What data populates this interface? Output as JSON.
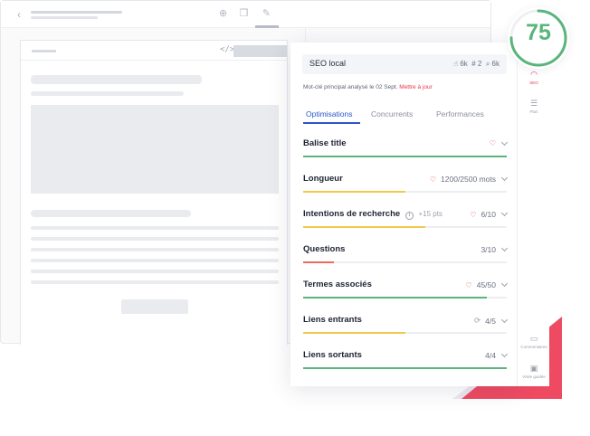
{
  "score": {
    "value": 75,
    "max": 100,
    "color": "#59b57b"
  },
  "keyword": {
    "text": "SEO local",
    "stat1": "6k",
    "rank": "# 2",
    "stat2": "6k"
  },
  "analysis": {
    "text": "Mot-clé principal analysé le 02 Sept.",
    "update_label": "Mettre à jour"
  },
  "tabs": [
    {
      "label": "Optimisations",
      "active": true
    },
    {
      "label": "Concurrents",
      "active": false
    },
    {
      "label": "Performances",
      "active": false
    }
  ],
  "rows": [
    {
      "label": "Balise title",
      "value": "",
      "icon": "trophy-icon",
      "progress": 1.0,
      "bar_color": "#59b57b"
    },
    {
      "label": "Longueur",
      "value": "1200/2500 mots",
      "icon": "trophy-icon",
      "progress": 0.5,
      "bar_color": "#f2c94c"
    },
    {
      "label": "Intentions de recherche",
      "extra": "+15 pts",
      "value": "6/10",
      "icon": "trophy-icon",
      "progress": 0.6,
      "bar_color": "#f2c94c"
    },
    {
      "label": "Questions",
      "value": "3/10",
      "icon": "",
      "progress": 0.15,
      "bar_color": "#ee6a5f"
    },
    {
      "label": "Termes associés",
      "value": "45/50",
      "icon": "trophy-icon",
      "progress": 0.9,
      "bar_color": "#59b57b"
    },
    {
      "label": "Liens entrants",
      "value": "4/5",
      "icon": "refresh-icon",
      "progress": 0.5,
      "bar_color": "#f2c94c"
    },
    {
      "label": "Liens sortants",
      "value": "4/4",
      "icon": "",
      "progress": 1.0,
      "bar_color": "#59b57b"
    }
  ],
  "rail": [
    {
      "label": "SEO",
      "icon": "gauge-icon",
      "active": true
    },
    {
      "label": "Plan",
      "icon": "list-icon",
      "active": false
    },
    {
      "label": "Commentaires",
      "icon": "comment-icon",
      "active": false
    },
    {
      "label": "Visite guidée",
      "icon": "guide-icon",
      "active": false
    }
  ],
  "colors": {
    "accent": "#2b56c7",
    "alert": "#e8334a",
    "good": "#59b57b",
    "mid": "#f2c94c",
    "bad": "#ee6a5f"
  }
}
